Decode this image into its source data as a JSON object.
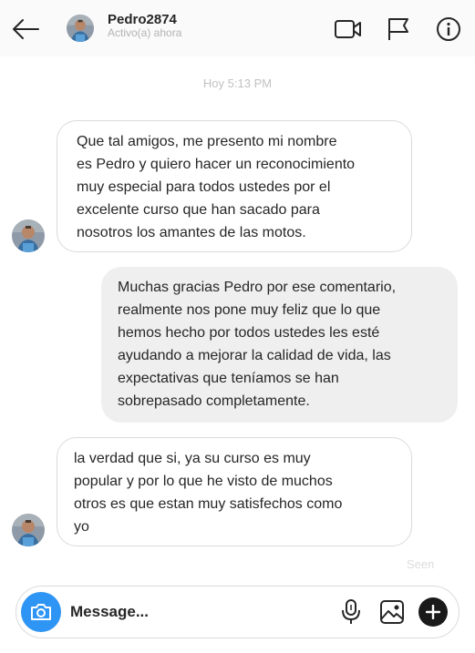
{
  "header": {
    "username": "Pedro2874",
    "status": "Activo(a) ahora",
    "icons": {
      "back": "arrow-left-icon",
      "video": "video-camera-icon",
      "flag": "flag-icon",
      "info": "info-icon"
    }
  },
  "conversation": {
    "timestamp": "Hoy 5:13 PM",
    "messages": [
      {
        "sender": "Pedro2874",
        "direction": "incoming",
        "lines": [
          "Que tal amigos, me presento mi nombre",
          "es Pedro y quiero hacer un reconocimiento",
          "muy especial para todos ustedes por el",
          "excelente curso que han sacado para",
          "nosotros los amantes de las motos."
        ]
      },
      {
        "sender": "me",
        "direction": "outgoing",
        "lines": [
          "Muchas gracias Pedro por ese comentario,",
          "realmente nos pone muy feliz que lo que",
          "hemos hecho por todos ustedes les esté",
          "ayudando a mejorar la calidad de vida, las",
          "expectativas que teníamos se han",
          "sobrepasado completamente."
        ]
      },
      {
        "sender": "Pedro2874",
        "direction": "incoming",
        "lines": [
          "la verdad que si, ya su curso es muy",
          "popular y por lo que he visto de muchos",
          "otros es que estan muy satisfechos como",
          "yo"
        ]
      }
    ],
    "seen_label": "Seen"
  },
  "composer": {
    "placeholder": "Message...",
    "icons": {
      "camera": "camera-icon",
      "mic": "microphone-icon",
      "gallery": "image-icon",
      "plus": "plus-icon"
    }
  },
  "colors": {
    "camera_button": "#2f95f4",
    "outgoing_bubble": "#efefef",
    "incoming_border": "#dbdbdb",
    "muted_text": "#b3b3b3"
  }
}
